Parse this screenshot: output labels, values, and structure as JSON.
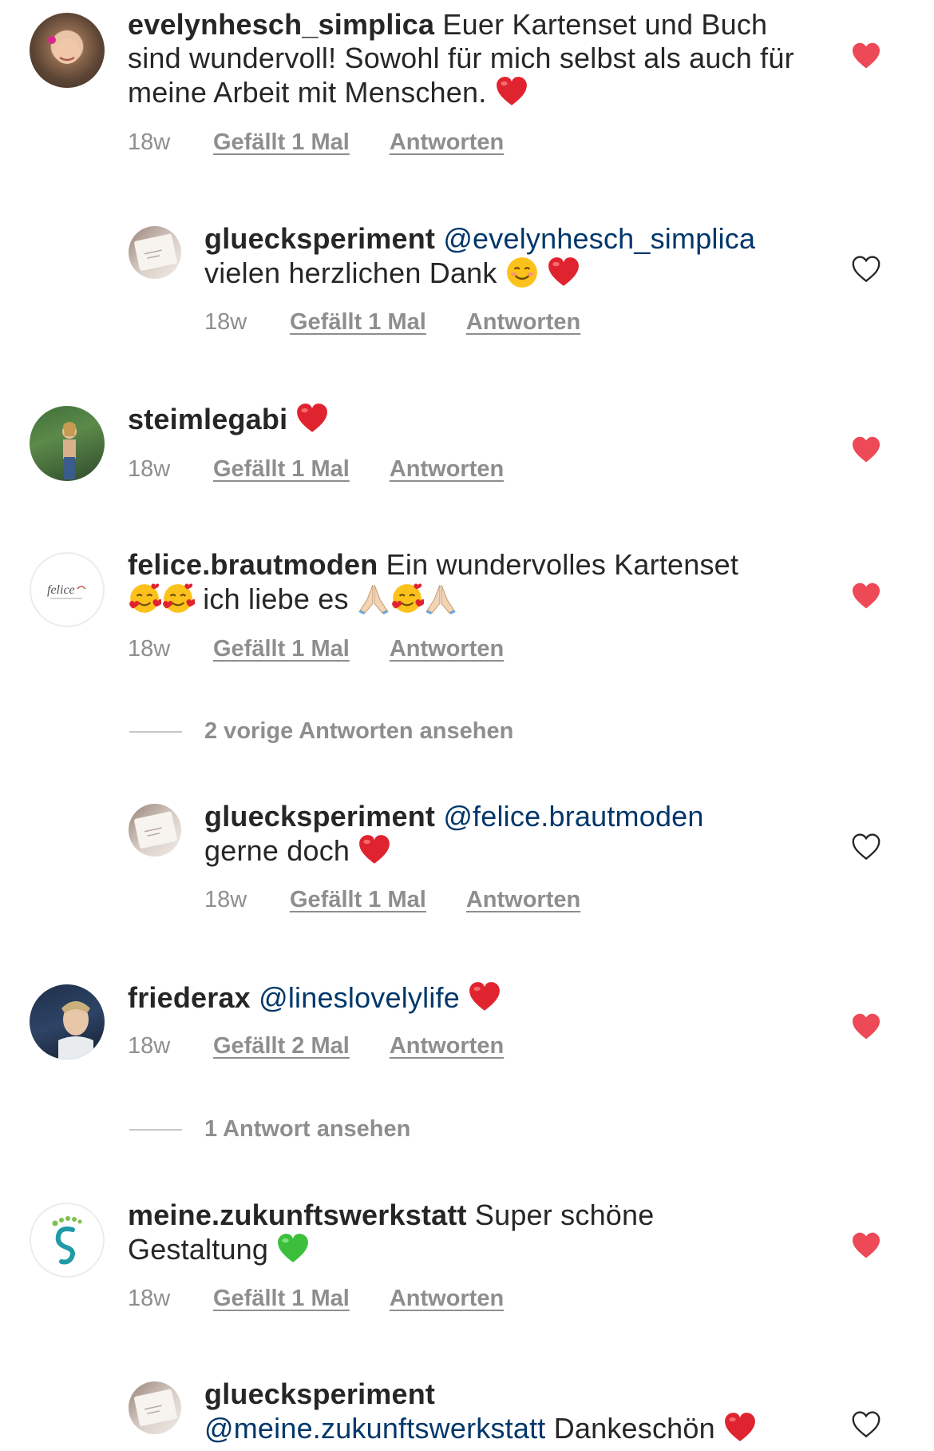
{
  "colors": {
    "liked_heart": "#ed4956",
    "mention": "#00376b",
    "meta": "#8e8e8e"
  },
  "comments": [
    {
      "username": "evelynhesch_simplica",
      "text": "Euer Kartenset und Buch sind wundervoll! Sowohl für mich selbst als auch für meine Arbeit mit Menschen.",
      "time": "18w",
      "likes": "Gefällt 1 Mal",
      "reply": "Antworten",
      "liked": true,
      "emoji": [
        "red-heart"
      ]
    },
    {
      "username": "gluecksperiment",
      "mention": "@evelynhesch_simplica",
      "text": "vielen herzlichen Dank",
      "time": "18w",
      "likes": "Gefällt 1 Mal",
      "reply": "Antworten",
      "liked": false,
      "emoji": [
        "smiling-face",
        "red-heart"
      ]
    },
    {
      "username": "steimlegabi",
      "text": "",
      "time": "18w",
      "likes": "Gefällt 1 Mal",
      "reply": "Antworten",
      "liked": true,
      "emoji": [
        "red-heart"
      ]
    },
    {
      "username": "felice.brautmoden",
      "text": "Ein wundervolles Kartenset",
      "text2": "ich liebe es",
      "time": "18w",
      "likes": "Gefällt 1 Mal",
      "reply": "Antworten",
      "liked": true,
      "avatar_text": "felice",
      "emoji": [
        "smiling-face-with-hearts",
        "smiling-face-with-hearts",
        "folded-hands",
        "smiling-face-with-hearts",
        "folded-hands"
      ]
    },
    {
      "view_replies": "2 vorige Antworten ansehen"
    },
    {
      "username": "gluecksperiment",
      "mention": "@felice.brautmoden",
      "text": "gerne doch",
      "time": "18w",
      "likes": "Gefällt 1 Mal",
      "reply": "Antworten",
      "liked": false,
      "emoji": [
        "red-heart"
      ]
    },
    {
      "username": "friederax",
      "mention": "@lineslovelylife",
      "time": "18w",
      "likes": "Gefällt 2 Mal",
      "reply": "Antworten",
      "liked": true,
      "emoji": [
        "red-heart"
      ]
    },
    {
      "view_replies": "1 Antwort ansehen"
    },
    {
      "username": "meine.zukunftswerkstatt",
      "text": "Super schöne",
      "text2": "Gestaltung",
      "time": "18w",
      "likes": "Gefällt 1 Mal",
      "reply": "Antworten",
      "liked": true,
      "emoji": [
        "green-heart"
      ]
    },
    {
      "username": "gluecksperiment",
      "mention": "@meine.zukunftswerkstatt",
      "text": "Dankeschön",
      "liked": false,
      "emoji": [
        "red-heart"
      ]
    }
  ]
}
